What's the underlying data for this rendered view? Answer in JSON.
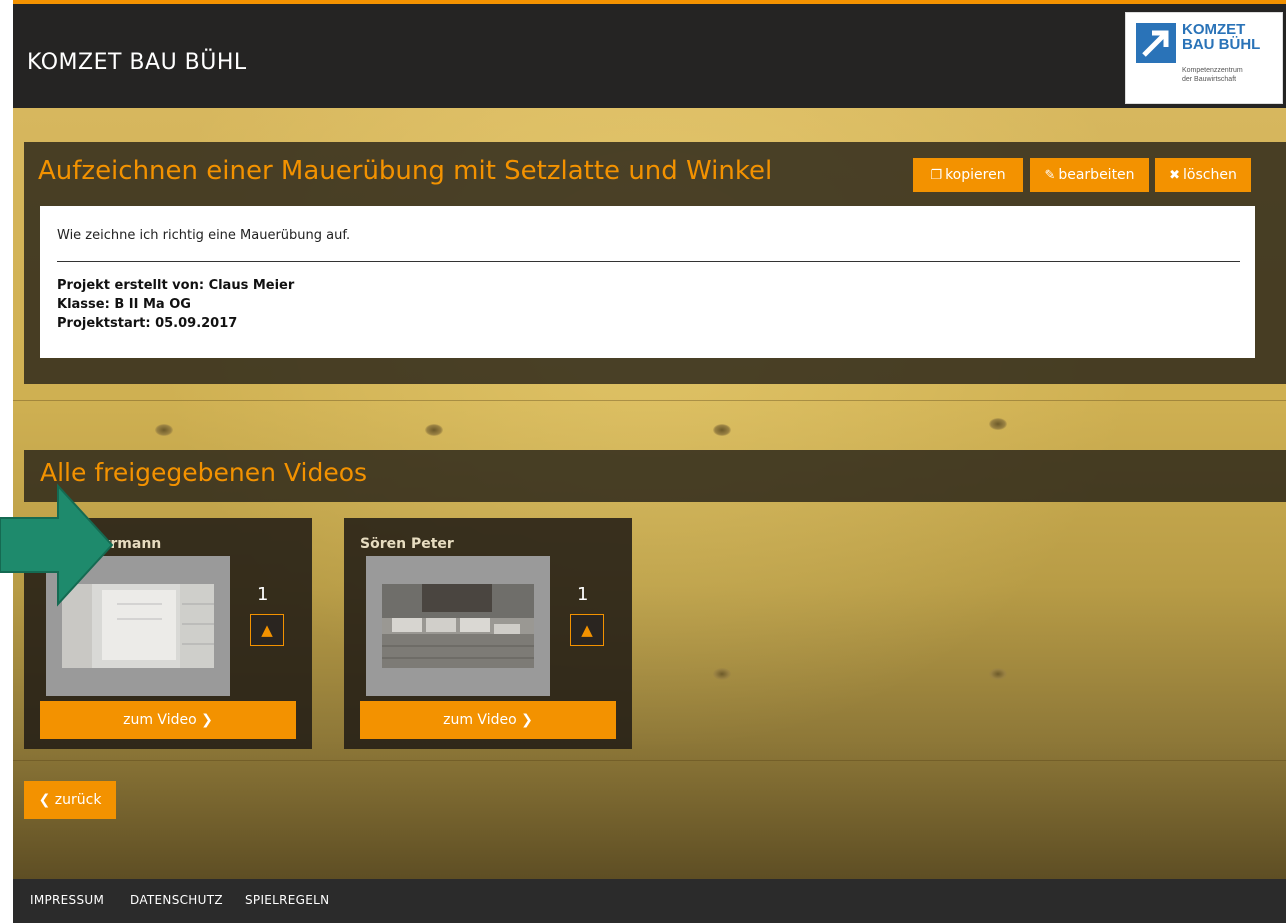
{
  "header": {
    "site_title": "KOMZET BAU BÜHL",
    "logo": {
      "line1": "KOMZET",
      "line2": "BAU BÜHL",
      "line3": "Kompetenzzentrum",
      "line4": "der Bauwirtschaft"
    }
  },
  "project": {
    "title": "Aufzeichnen einer Mauerübung mit Setzlatte und Winkel",
    "actions": {
      "copy_label": "kopieren",
      "edit_label": "bearbeiten",
      "delete_label": "löschen"
    },
    "description": "Wie zeichne ich richtig eine Mauerübung auf.",
    "created_by": "Projekt erstellt von: Claus Meier",
    "class": "Klasse: B II Ma OG",
    "start": "Projektstart: 05.09.2017"
  },
  "videos": {
    "heading": "Alle freigegebenen Videos",
    "items": [
      {
        "name": "errmann",
        "likes": "1",
        "button_label": "zum Video"
      },
      {
        "name": "Sören Peter",
        "likes": "1",
        "button_label": "zum Video"
      }
    ]
  },
  "back_label": "zurück",
  "footer": {
    "links": [
      "IMPRESSUM",
      "DATENSCHUTZ",
      "SPIELREGELN"
    ]
  },
  "colors": {
    "accent": "#f39200",
    "header_bg": "#252423",
    "arrow": "#1e8a6c"
  },
  "icons": {
    "copy": "copy-icon",
    "edit": "pencil-icon",
    "delete": "times-icon",
    "like": "thumbs-up-icon",
    "video_arrow": "chevron-right-icon",
    "back": "chevron-left-icon"
  }
}
